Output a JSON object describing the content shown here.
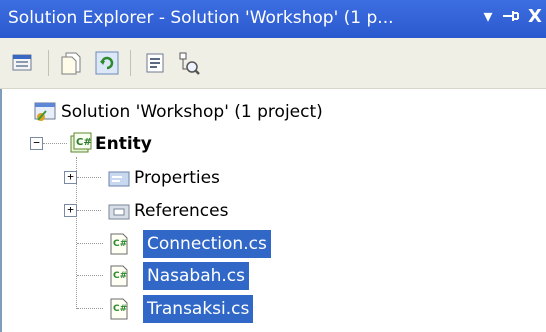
{
  "window": {
    "title": "Solution Explorer - Solution 'Workshop' (1 p...",
    "dropdown_icon": "▾",
    "pin_icon": "⊣",
    "close_icon": "X"
  },
  "toolbar": {
    "buttons": [
      {
        "name": "properties-icon"
      },
      {
        "name": "show-all-files-icon"
      },
      {
        "name": "refresh-icon"
      },
      {
        "name": "view-code-icon"
      },
      {
        "name": "class-view-icon"
      }
    ]
  },
  "tree": {
    "solution_label": "Solution 'Workshop' (1 project)",
    "project_label": "Entity",
    "project_expander": "−",
    "items": [
      {
        "label": "Properties",
        "expander": "+",
        "selected": false,
        "icon": "properties-folder-icon"
      },
      {
        "label": "References",
        "expander": "+",
        "selected": false,
        "icon": "references-folder-icon"
      },
      {
        "label": "Connection.cs",
        "selected": true,
        "icon": "csharp-file-icon"
      },
      {
        "label": "Nasabah.cs",
        "selected": true,
        "icon": "csharp-file-icon"
      },
      {
        "label": "Transaksi.cs",
        "selected": true,
        "icon": "csharp-file-icon"
      }
    ]
  },
  "colors": {
    "titlebar": "#2a59cf",
    "selection": "#3168c8",
    "toolbar": "#f0efe6"
  }
}
